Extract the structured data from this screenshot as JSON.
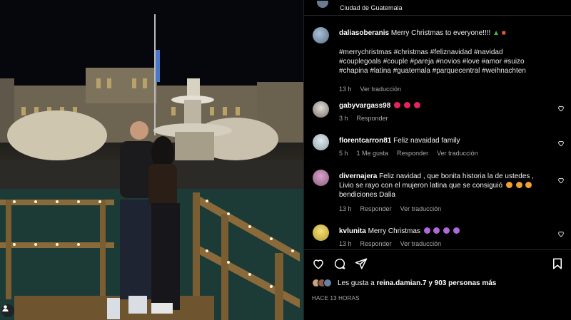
{
  "post": {
    "location": "Ciudad de Guatemala"
  },
  "caption": {
    "user": "daliasoberanis",
    "text": "Merry Christmas to everyone!!!!",
    "hashtags_line1": "#merrychristmas #christmas #feliznavidad #navidad",
    "hashtags_line2": "#couplegoals #couple #pareja #novios #love #amor #suizo",
    "hashtags_line3": "#chapina #latina #guatemala #parquecentral #weihnachten",
    "time": "13 h",
    "see_translation": "Ver traducción"
  },
  "comments": [
    {
      "user": "gabyvargass98",
      "text": "",
      "time": "3 h",
      "reply": "Responder",
      "likes": "",
      "translation": ""
    },
    {
      "user": "florentcarron81",
      "text": "Feliz navaidad family",
      "time": "5 h",
      "likes": "1 Me gusta",
      "reply": "Responder",
      "translation": "Ver traducción"
    },
    {
      "user": "divernajera",
      "text_line1": "Feliz navidad , que bonita historia la de ustedes ,",
      "text_line2": "Livio se rayo con el mujeron latina que se consiguió",
      "text_line3": "bendiciones Dalia",
      "time": "13 h",
      "reply": "Responder",
      "translation": "Ver traducción"
    },
    {
      "user": "kvlunita",
      "text": "Merry Christmas",
      "time": "13 h",
      "reply": "Responder",
      "translation": "Ver traducción"
    }
  ],
  "likes": {
    "prefix": "Les gusta a",
    "user": "reina.damian.7",
    "suffix": "y 903 personas más"
  },
  "date": "HACE 13 HORAS",
  "icons": {
    "like": "heart-icon",
    "comment": "comment-icon",
    "share": "send-icon",
    "save": "bookmark-icon"
  },
  "colors": {
    "background": "#000000",
    "muted": "#a8a8a8",
    "christmas_red": "#e0245e"
  }
}
